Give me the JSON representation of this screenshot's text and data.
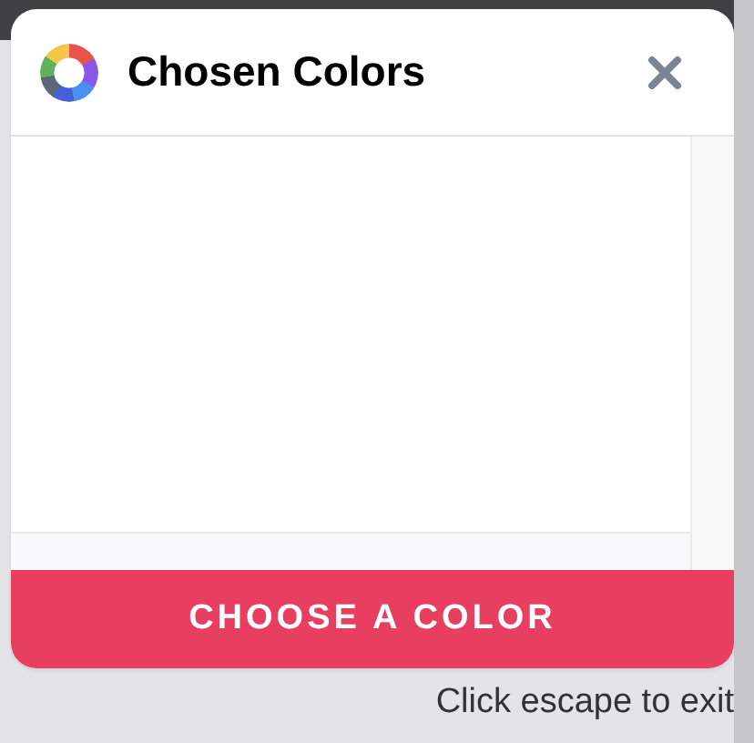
{
  "dialog": {
    "title": "Chosen Colors",
    "action_button": "CHOOSE A COLOR"
  },
  "hint": "Click escape to exit"
}
